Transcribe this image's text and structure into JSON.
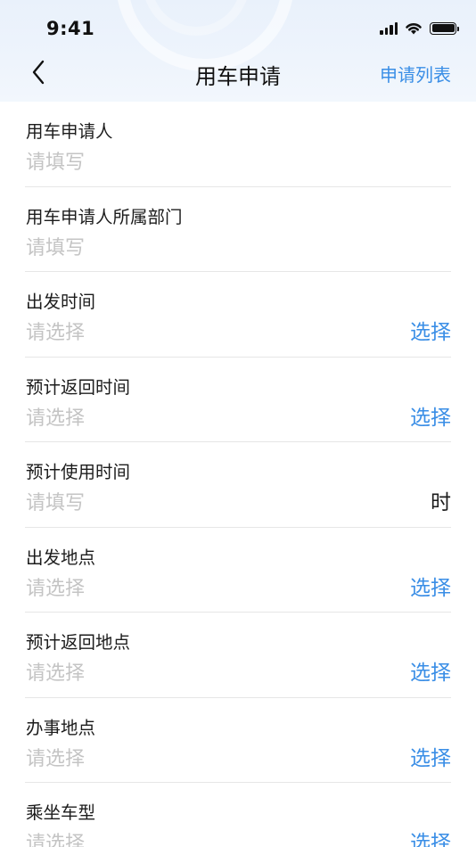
{
  "status_bar": {
    "time": "9:41"
  },
  "nav": {
    "title": "用车申请",
    "right_link": "申请列表",
    "back_icon": "chevron-left-icon"
  },
  "form": {
    "applicant": {
      "label": "用车申请人",
      "placeholder": "请填写"
    },
    "department": {
      "label": "用车申请人所属部门",
      "placeholder": "请填写"
    },
    "departure_time": {
      "label": "出发时间",
      "placeholder": "请选择",
      "action": "选择"
    },
    "return_time": {
      "label": "预计返回时间",
      "placeholder": "请选择",
      "action": "选择"
    },
    "usage_duration": {
      "label": "预计使用时间",
      "placeholder": "请填写",
      "unit": "时"
    },
    "departure_place": {
      "label": "出发地点",
      "placeholder": "请选择",
      "action": "选择"
    },
    "return_place": {
      "label": "预计返回地点",
      "placeholder": "请选择",
      "action": "选择"
    },
    "business_place": {
      "label": "办事地点",
      "placeholder": "请选择",
      "action": "选择"
    },
    "vehicle_type": {
      "label": "乘坐车型",
      "placeholder": "请选择",
      "action": "选择"
    }
  },
  "colors": {
    "accent": "#3a8ee6",
    "placeholder": "#c4c4c4",
    "divider": "#e6e6e6",
    "header_bg": "#eef4fc"
  }
}
